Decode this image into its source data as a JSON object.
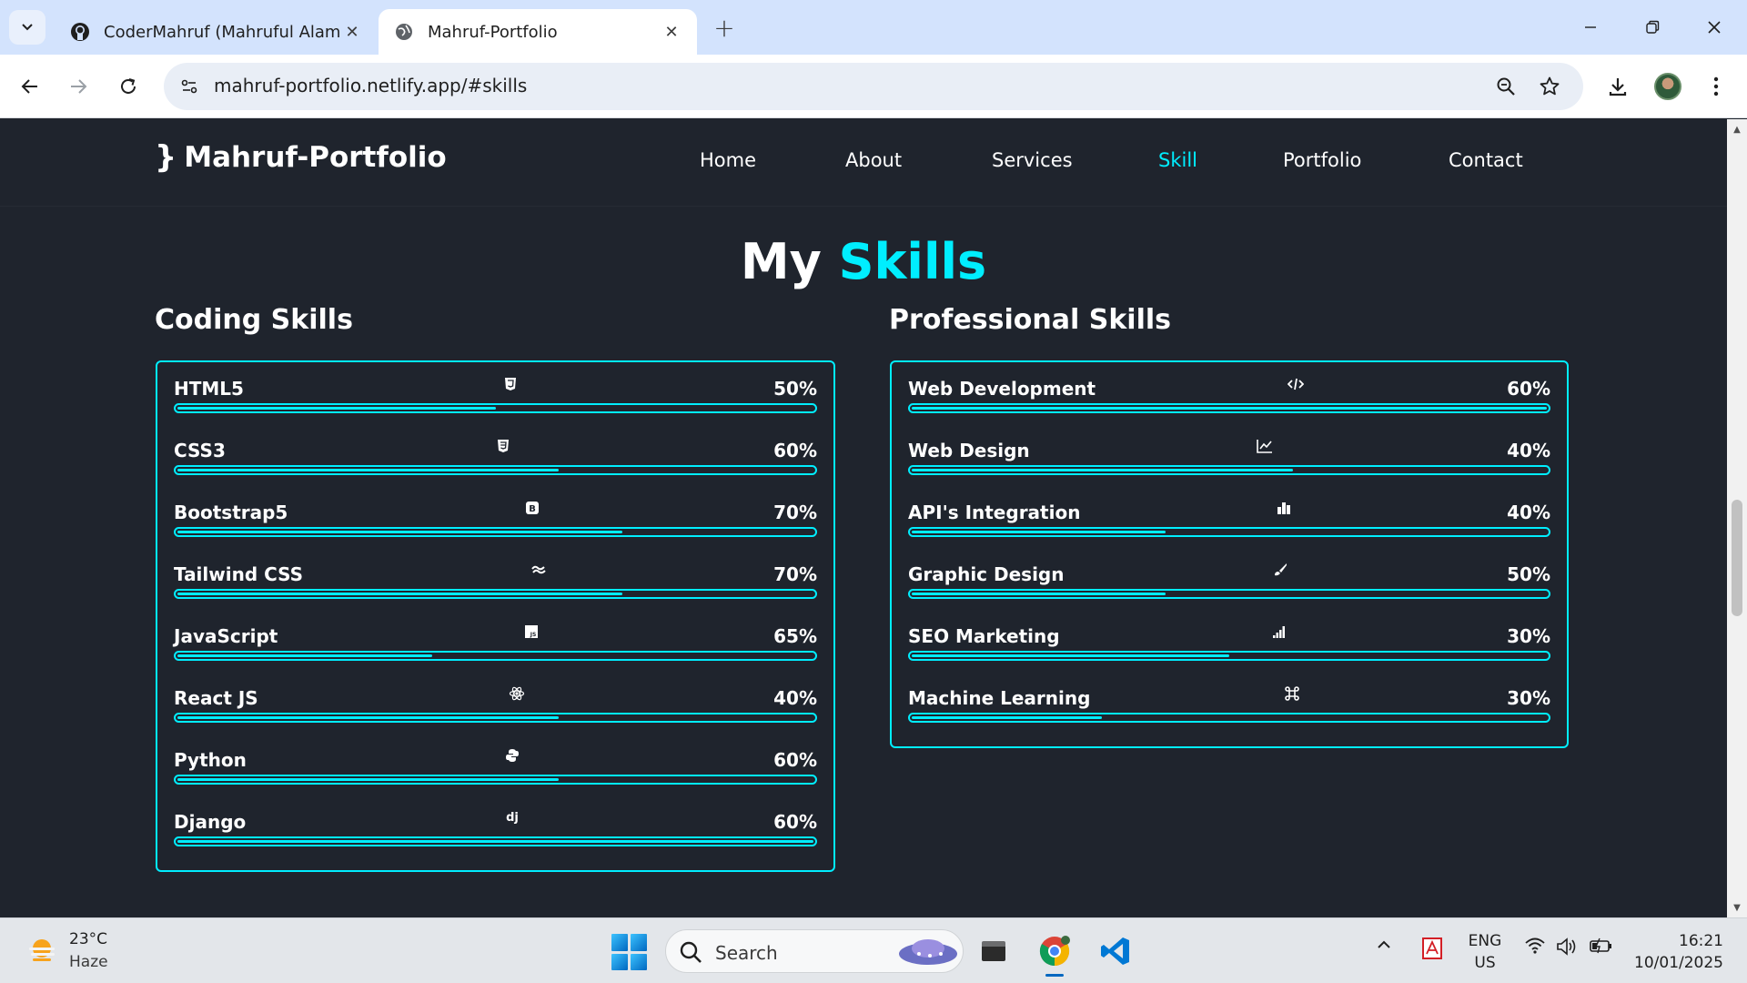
{
  "browser": {
    "tabs": [
      {
        "title": "CoderMahruf (Mahruful Alam)",
        "icon": "github-icon",
        "active": false
      },
      {
        "title": "Mahruf-Portfolio",
        "icon": "globe-icon",
        "active": true
      }
    ],
    "url": "mahruf-portfolio.netlify.app/#skills"
  },
  "site": {
    "logo_brace": "}",
    "logo": "Mahruf-Portfolio",
    "nav": [
      {
        "label": "Home",
        "active": false
      },
      {
        "label": "About",
        "active": false
      },
      {
        "label": "Services",
        "active": false
      },
      {
        "label": "Skill",
        "active": true
      },
      {
        "label": "Portfolio",
        "active": false
      },
      {
        "label": "Contact",
        "active": false
      }
    ],
    "accent_color": "#00eeff",
    "background_color": "#1f242d"
  },
  "skills": {
    "title_prefix": "My",
    "title_accent": "Skills",
    "coding": {
      "heading": "Coding Skills",
      "items": [
        {
          "name": "HTML5",
          "percent": "50%",
          "fill": 0.5,
          "icon": "html5-icon"
        },
        {
          "name": "CSS3",
          "percent": "60%",
          "fill": 0.6,
          "icon": "css3-icon"
        },
        {
          "name": "Bootstrap5",
          "percent": "70%",
          "fill": 0.7,
          "icon": "bootstrap-icon"
        },
        {
          "name": "Tailwind CSS",
          "percent": "70%",
          "fill": 0.7,
          "icon": "tailwind-icon"
        },
        {
          "name": "JavaScript",
          "percent": "65%",
          "fill": 0.4,
          "icon": "javascript-icon"
        },
        {
          "name": "React JS",
          "percent": "40%",
          "fill": 0.6,
          "icon": "react-icon"
        },
        {
          "name": "Python",
          "percent": "60%",
          "fill": 0.6,
          "icon": "python-icon"
        },
        {
          "name": "Django",
          "percent": "60%",
          "fill": 1.0,
          "icon": "django-icon"
        }
      ]
    },
    "professional": {
      "heading": "Professional Skills",
      "items": [
        {
          "name": "Web Development",
          "percent": "60%",
          "fill": 1.0,
          "icon": "code-icon"
        },
        {
          "name": "Web Design",
          "percent": "40%",
          "fill": 0.6,
          "icon": "chart-line-icon"
        },
        {
          "name": "API's Integration",
          "percent": "40%",
          "fill": 0.4,
          "icon": "chart-bar-icon"
        },
        {
          "name": "Graphic Design",
          "percent": "50%",
          "fill": 0.4,
          "icon": "brush-icon"
        },
        {
          "name": "SEO Marketing",
          "percent": "30%",
          "fill": 0.5,
          "icon": "signal-icon"
        },
        {
          "name": "Machine Learning",
          "percent": "30%",
          "fill": 0.3,
          "icon": "command-icon"
        }
      ]
    }
  },
  "taskbar": {
    "weather_temp": "23°C",
    "weather_desc": "Haze",
    "search_placeholder": "Search",
    "lang_line1": "ENG",
    "lang_line2": "US",
    "time": "16:21",
    "date": "10/01/2025"
  }
}
